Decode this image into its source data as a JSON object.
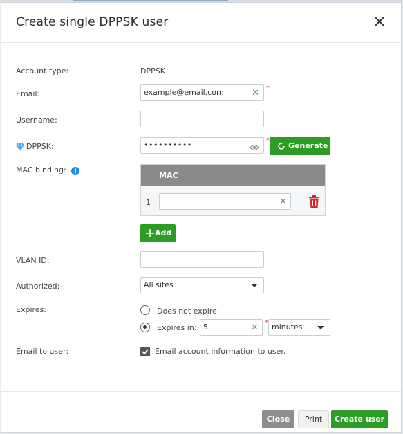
{
  "dialog": {
    "title": "Create single DPPSK user"
  },
  "form": {
    "account_type": {
      "label": "Account type:",
      "value": "DPPSK"
    },
    "email": {
      "label": "Email:",
      "value": "example@email.com",
      "clear": "✕",
      "required": "*"
    },
    "username": {
      "label": "Username:",
      "value": ""
    },
    "dppsk": {
      "label": "DPPSK:",
      "value": "••••••••••",
      "required": "*",
      "generate_label": "Generate"
    },
    "mac_binding": {
      "label": "MAC binding:",
      "column_header": "MAC",
      "rows": [
        {
          "index": "1",
          "value": "",
          "clear": "✕"
        }
      ],
      "add_label": "Add"
    },
    "vlan_id": {
      "label": "VLAN ID:",
      "value": ""
    },
    "authorized": {
      "label": "Authorized:",
      "selected": "All sites"
    },
    "expires": {
      "label": "Expires:",
      "option_never": "Does not expire",
      "option_in": "Expires in:",
      "amount": "5",
      "clear": "✕",
      "required": "*",
      "unit": "minutes"
    },
    "email_to_user": {
      "label": "Email to user:",
      "checkbox_label": "Email account information to user.",
      "checked": true
    }
  },
  "footer": {
    "close_label": "Close",
    "print_label": "Print",
    "create_label": "Create user"
  },
  "colors": {
    "primary_green": "#2c9c25",
    "delete_red": "#d9232d",
    "info_blue": "#1c8fe0",
    "gem_blue": "#3aa8e8"
  }
}
